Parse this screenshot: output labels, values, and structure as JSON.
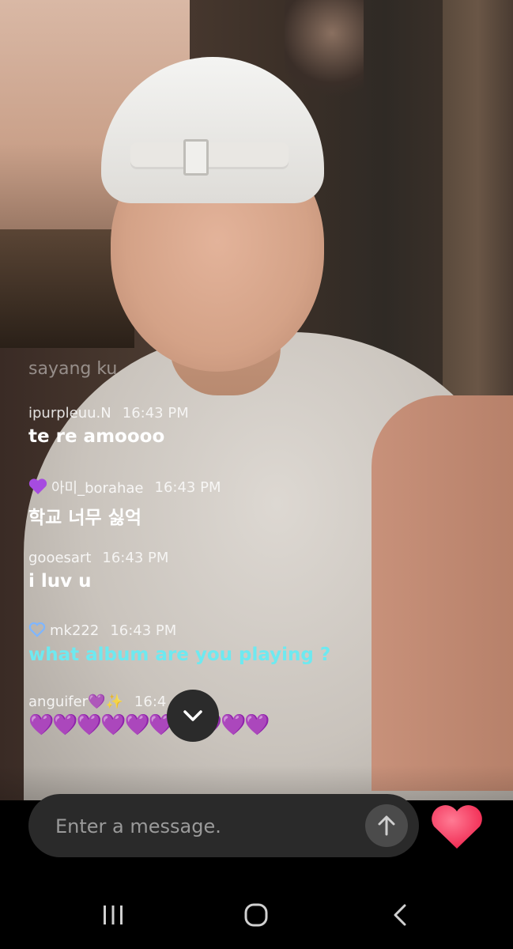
{
  "chat": {
    "ghost_text": "sayang ku",
    "messages": [
      {
        "user": "ipurpleuu.N",
        "time": "16:43 PM",
        "text": "te re amoooo"
      },
      {
        "badge": "purple-heart",
        "user": "아미_borahae",
        "time": "16:43 PM",
        "text": "학교 너무 싫억"
      },
      {
        "user": "gooesart",
        "time": "16:43 PM",
        "text": "i luv u"
      },
      {
        "badge": "blue-outline-heart",
        "user": "mk222",
        "time": "16:43 PM",
        "text": "what album are you playing ?",
        "text_color": "#6ee9f0"
      },
      {
        "user": "anguifer💜✨",
        "time": "16:4",
        "text": "💜💜💜💜💜💜💜💜💜💜"
      }
    ]
  },
  "input": {
    "placeholder": "Enter a message."
  },
  "icons": {
    "scroll_down": "chevron-down-icon",
    "send": "arrow-up-icon",
    "like": "heart-icon",
    "nav_recent": "recent-apps-icon",
    "nav_home": "home-icon",
    "nav_back": "back-icon"
  },
  "colors": {
    "heart": "#ff3b5c",
    "teal_text": "#6ee9f0",
    "purple_heart": "#a64be0"
  }
}
